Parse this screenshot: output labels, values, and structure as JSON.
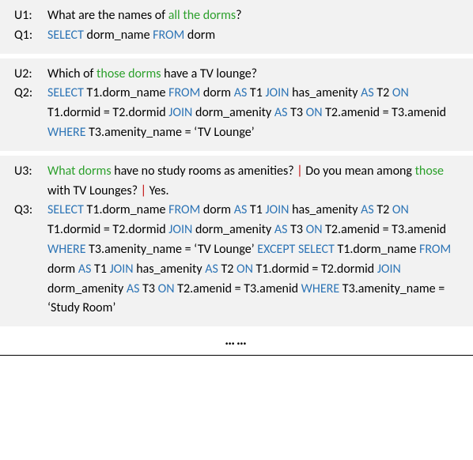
{
  "blocks": [
    {
      "shaded": true,
      "rows": [
        {
          "label": "U1:",
          "tokens": [
            {
              "t": "What are the names of ",
              "c": ""
            },
            {
              "t": "all the dorms",
              "c": "coref"
            },
            {
              "t": "?",
              "c": ""
            }
          ]
        },
        {
          "label": "Q1:",
          "tokens": [
            {
              "t": "SELECT",
              "c": "kw"
            },
            {
              "t": " dorm_name ",
              "c": ""
            },
            {
              "t": "FROM",
              "c": "kw"
            },
            {
              "t": " dorm",
              "c": ""
            }
          ]
        }
      ]
    },
    {
      "shaded": true,
      "rows": [
        {
          "label": "U2:",
          "tokens": [
            {
              "t": "Which of ",
              "c": ""
            },
            {
              "t": "those dorms",
              "c": "coref"
            },
            {
              "t": " have a TV lounge?",
              "c": ""
            }
          ]
        },
        {
          "label": "Q2:",
          "tokens": [
            {
              "t": "SELECT",
              "c": "kw"
            },
            {
              "t": " T1.dorm_name ",
              "c": ""
            },
            {
              "t": "FROM",
              "c": "kw"
            },
            {
              "t": " dorm ",
              "c": ""
            },
            {
              "t": "AS",
              "c": "kw"
            },
            {
              "t": " T1 ",
              "c": ""
            },
            {
              "t": "JOIN",
              "c": "kw"
            },
            {
              "t": " has_amenity ",
              "c": ""
            },
            {
              "t": "AS",
              "c": "kw"
            },
            {
              "t": " T2 ",
              "c": ""
            },
            {
              "t": "ON",
              "c": "kw"
            },
            {
              "t": " T1.dormid = T2.dormid ",
              "c": ""
            },
            {
              "t": "JOIN",
              "c": "kw"
            },
            {
              "t": " dorm_amenity ",
              "c": ""
            },
            {
              "t": "AS",
              "c": "kw"
            },
            {
              "t": " T3 ",
              "c": ""
            },
            {
              "t": "ON",
              "c": "kw"
            },
            {
              "t": " T2.amenid = T3.amenid ",
              "c": ""
            },
            {
              "t": "WHERE",
              "c": "kw"
            },
            {
              "t": " T3.amenity_name = ‘TV Lounge’",
              "c": ""
            }
          ]
        }
      ]
    },
    {
      "shaded": true,
      "rows": [
        {
          "label": "U3:",
          "tokens": [
            {
              "t": "What dorms",
              "c": "coref"
            },
            {
              "t": " have no study rooms as amenities? ",
              "c": ""
            },
            {
              "t": "|",
              "c": "sep"
            },
            {
              "t": " Do you mean among ",
              "c": ""
            },
            {
              "t": "those",
              "c": "coref"
            },
            {
              "t": " with TV Lounges? ",
              "c": ""
            },
            {
              "t": "|",
              "c": "sep"
            },
            {
              "t": " Yes.",
              "c": ""
            }
          ]
        },
        {
          "label": "Q3:",
          "tokens": [
            {
              "t": "SELECT",
              "c": "kw"
            },
            {
              "t": " T1.dorm_name ",
              "c": ""
            },
            {
              "t": "FROM",
              "c": "kw"
            },
            {
              "t": " dorm ",
              "c": ""
            },
            {
              "t": "AS",
              "c": "kw"
            },
            {
              "t": " T1 ",
              "c": ""
            },
            {
              "t": "JOIN",
              "c": "kw"
            },
            {
              "t": " has_amenity ",
              "c": ""
            },
            {
              "t": "AS",
              "c": "kw"
            },
            {
              "t": " T2 ",
              "c": ""
            },
            {
              "t": "ON",
              "c": "kw"
            },
            {
              "t": " T1.dormid = T2.dormid ",
              "c": ""
            },
            {
              "t": "JOIN",
              "c": "kw"
            },
            {
              "t": " dorm_amenity ",
              "c": ""
            },
            {
              "t": "AS",
              "c": "kw"
            },
            {
              "t": " T3 ",
              "c": ""
            },
            {
              "t": "ON",
              "c": "kw"
            },
            {
              "t": " T2.amenid = T3.amenid ",
              "c": ""
            },
            {
              "t": "WHERE",
              "c": "kw"
            },
            {
              "t": " T3.amenity_name = ‘TV Lounge’ ",
              "c": ""
            },
            {
              "t": "EXCEPT",
              "c": "kw"
            },
            {
              "t": " ",
              "c": ""
            },
            {
              "t": "SELECT",
              "c": "kw"
            },
            {
              "t": " T1.dorm_name ",
              "c": ""
            },
            {
              "t": "FROM",
              "c": "kw"
            },
            {
              "t": " dorm ",
              "c": ""
            },
            {
              "t": "AS",
              "c": "kw"
            },
            {
              "t": " T1 ",
              "c": ""
            },
            {
              "t": "JOIN",
              "c": "kw"
            },
            {
              "t": " has_amenity ",
              "c": ""
            },
            {
              "t": "AS",
              "c": "kw"
            },
            {
              "t": " T2 ",
              "c": ""
            },
            {
              "t": "ON",
              "c": "kw"
            },
            {
              "t": " T1.dormid = T2.dormid ",
              "c": ""
            },
            {
              "t": "JOIN",
              "c": "kw"
            },
            {
              "t": " dorm_amenity ",
              "c": ""
            },
            {
              "t": "AS",
              "c": "kw"
            },
            {
              "t": " T3 ",
              "c": ""
            },
            {
              "t": "ON",
              "c": "kw"
            },
            {
              "t": " T2.amenid = T3.amenid ",
              "c": ""
            },
            {
              "t": "WHERE",
              "c": "kw"
            },
            {
              "t": " T3.amenity_name = ‘Study Room’",
              "c": ""
            }
          ]
        }
      ]
    }
  ],
  "ellipsis": "……"
}
